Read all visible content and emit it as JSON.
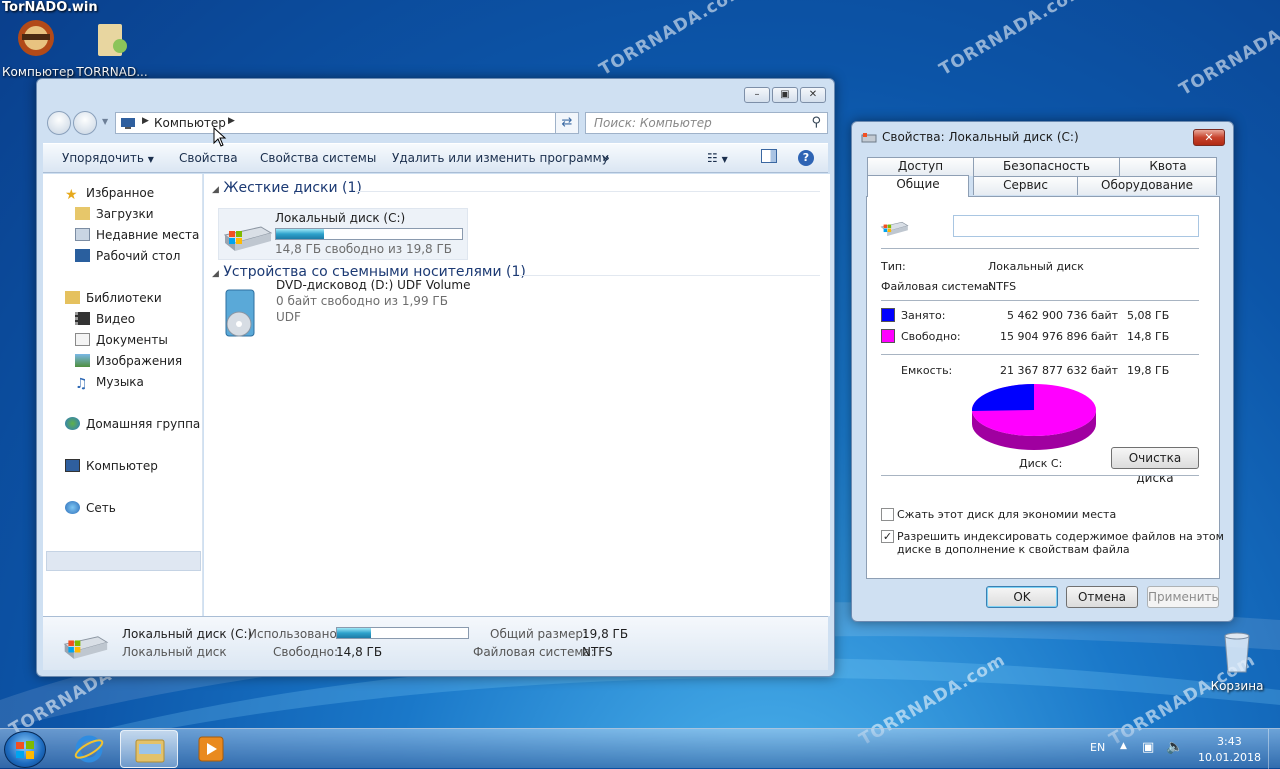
{
  "desktop": {
    "site_label": "TorNADO.win",
    "icons": [
      {
        "label": "Компьютер",
        "icon": "computer-icon"
      },
      {
        "label": "TORRNAD...",
        "icon": "folder-user-icon"
      },
      {
        "label": "Корзина",
        "icon": "recycle-bin-icon"
      }
    ],
    "watermark": "TORRNADA.com"
  },
  "explorer": {
    "address": {
      "crumb": "Компьютер"
    },
    "search_placeholder": "Поиск: Компьютер",
    "toolbar": {
      "organize": "Упорядочить",
      "properties": "Свойства",
      "system_properties": "Свойства системы",
      "uninstall": "Удалить или изменить программу",
      "more": "»"
    },
    "nav": {
      "favorites": "Избранное",
      "downloads": "Загрузки",
      "recent": "Недавние места",
      "desktop": "Рабочий стол",
      "libraries": "Библиотеки",
      "video": "Видео",
      "documents": "Документы",
      "pictures": "Изображения",
      "music": "Музыка",
      "homegroup": "Домашняя группа",
      "computer": "Компьютер",
      "network": "Сеть"
    },
    "groups": {
      "hard_disks": "Жесткие диски (1)",
      "removable": "Устройства со съемными носителями (1)"
    },
    "drive_c": {
      "name": "Локальный диск (C:)",
      "free_text": "14,8 ГБ свободно из 19,8 ГБ",
      "used_fraction": 0.26
    },
    "dvd": {
      "name": "DVD-дисковод (D:) UDF Volume",
      "free_text": "0 байт свободно из 1,99 ГБ",
      "fs": "UDF"
    },
    "details": {
      "name": "Локальный диск (C:)",
      "type": "Локальный диск",
      "used_label": "Использовано:",
      "used_fraction": 0.26,
      "free_label": "Свободно:",
      "free_value": "14,8 ГБ",
      "total_label": "Общий размер:",
      "total_value": "19,8 ГБ",
      "fs_label": "Файловая система:",
      "fs_value": "NTFS"
    }
  },
  "props": {
    "title": "Свойства: Локальный диск (C:)",
    "tabs_back": [
      "Доступ",
      "Безопасность",
      "Квота"
    ],
    "tabs_front": [
      "Общие",
      "Сервис",
      "Оборудование"
    ],
    "type_label": "Тип:",
    "type_value": "Локальный диск",
    "fs_label": "Файловая система:",
    "fs_value": "NTFS",
    "used_label": "Занято:",
    "used_bytes": "5 462 900 736 байт",
    "used_gb": "5,08 ГБ",
    "free_label": "Свободно:",
    "free_bytes": "15 904 976 896 байт",
    "free_gb": "14,8 ГБ",
    "cap_label": "Емкость:",
    "cap_bytes": "21 367 877 632 байт",
    "cap_gb": "19,8 ГБ",
    "disk_label": "Диск C:",
    "cleanup": "Очистка диска",
    "compress": "Сжать этот диск для экономии места",
    "index_line1": "Разрешить индексировать содержимое файлов на этом",
    "index_line2": "диске в дополнение к свойствам файла",
    "ok": "OK",
    "cancel": "Отмена",
    "apply": "Применить",
    "used_color": "#0000ff",
    "free_color": "#ff00ff",
    "used_fraction": 0.256
  },
  "taskbar": {
    "lang": "EN",
    "time": "3:43",
    "date": "10.01.2018"
  }
}
